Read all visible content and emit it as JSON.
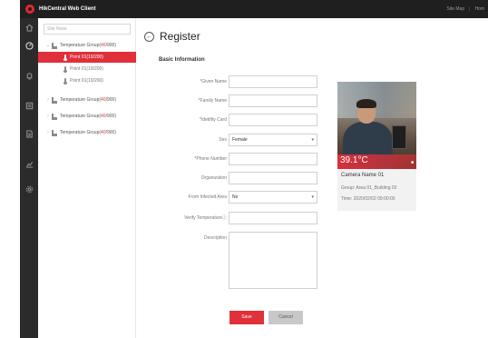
{
  "app": {
    "title": "HikCentral Web Client",
    "top_links": [
      "Site Map",
      "Hom"
    ]
  },
  "sidebar": {
    "items": [
      {
        "icon": "home-icon"
      },
      {
        "icon": "dashboard-icon"
      },
      {
        "icon": "bell-icon"
      },
      {
        "icon": "list-icon"
      },
      {
        "icon": "document-icon"
      },
      {
        "icon": "chart-icon"
      },
      {
        "icon": "gear-icon"
      }
    ]
  },
  "tree": {
    "search_placeholder": "Site Nose",
    "items": [
      {
        "type": "group",
        "expanded": true,
        "label": "Temperature Group(",
        "count": "40",
        "suffix": "/900)"
      },
      {
        "type": "point",
        "selected": true,
        "label": "Point 01(19/200)"
      },
      {
        "type": "point",
        "selected": false,
        "label": "Point 01(19/200)"
      },
      {
        "type": "point",
        "selected": false,
        "label": "Point 01(19/200)"
      },
      {
        "type": "group",
        "expanded": false,
        "label": "Temperature Group(",
        "count": "40",
        "suffix": "/900)"
      },
      {
        "type": "group",
        "expanded": false,
        "label": "Temperature Group(",
        "count": "40",
        "suffix": "/900)"
      },
      {
        "type": "group",
        "expanded": false,
        "label": "Temperature Group(",
        "count": "40",
        "suffix": "/900)"
      }
    ]
  },
  "page": {
    "title": "Register",
    "section": "Basic Information"
  },
  "form": {
    "given_name": {
      "label": "*Given Name",
      "value": ""
    },
    "family_name": {
      "label": "*Family Name",
      "value": ""
    },
    "id_card": {
      "label": "*Idetifity Card",
      "value": ""
    },
    "sex": {
      "label": "Sex",
      "value": "Female"
    },
    "phone": {
      "label": "*Phone Number",
      "value": ""
    },
    "organization": {
      "label": "Organization",
      "value": ""
    },
    "infected_area": {
      "label": "From Infected Area",
      "value": "No"
    },
    "verify_temp": {
      "label": "Verify Temperature",
      "help": "ⓘ",
      "value": ""
    },
    "description": {
      "label": "Description",
      "value": ""
    }
  },
  "buttons": {
    "save": "Save",
    "cancel": "Cancel"
  },
  "camera": {
    "temperature": "39.1°C",
    "name": "Camera Name 01",
    "group": "Group:  Area 01_Building 02",
    "time": "Time:  2020/02/02 09:00:00"
  },
  "colors": {
    "accent": "#e0303a",
    "topbar": "#1f1f1f",
    "rail": "#2b2b2b"
  }
}
